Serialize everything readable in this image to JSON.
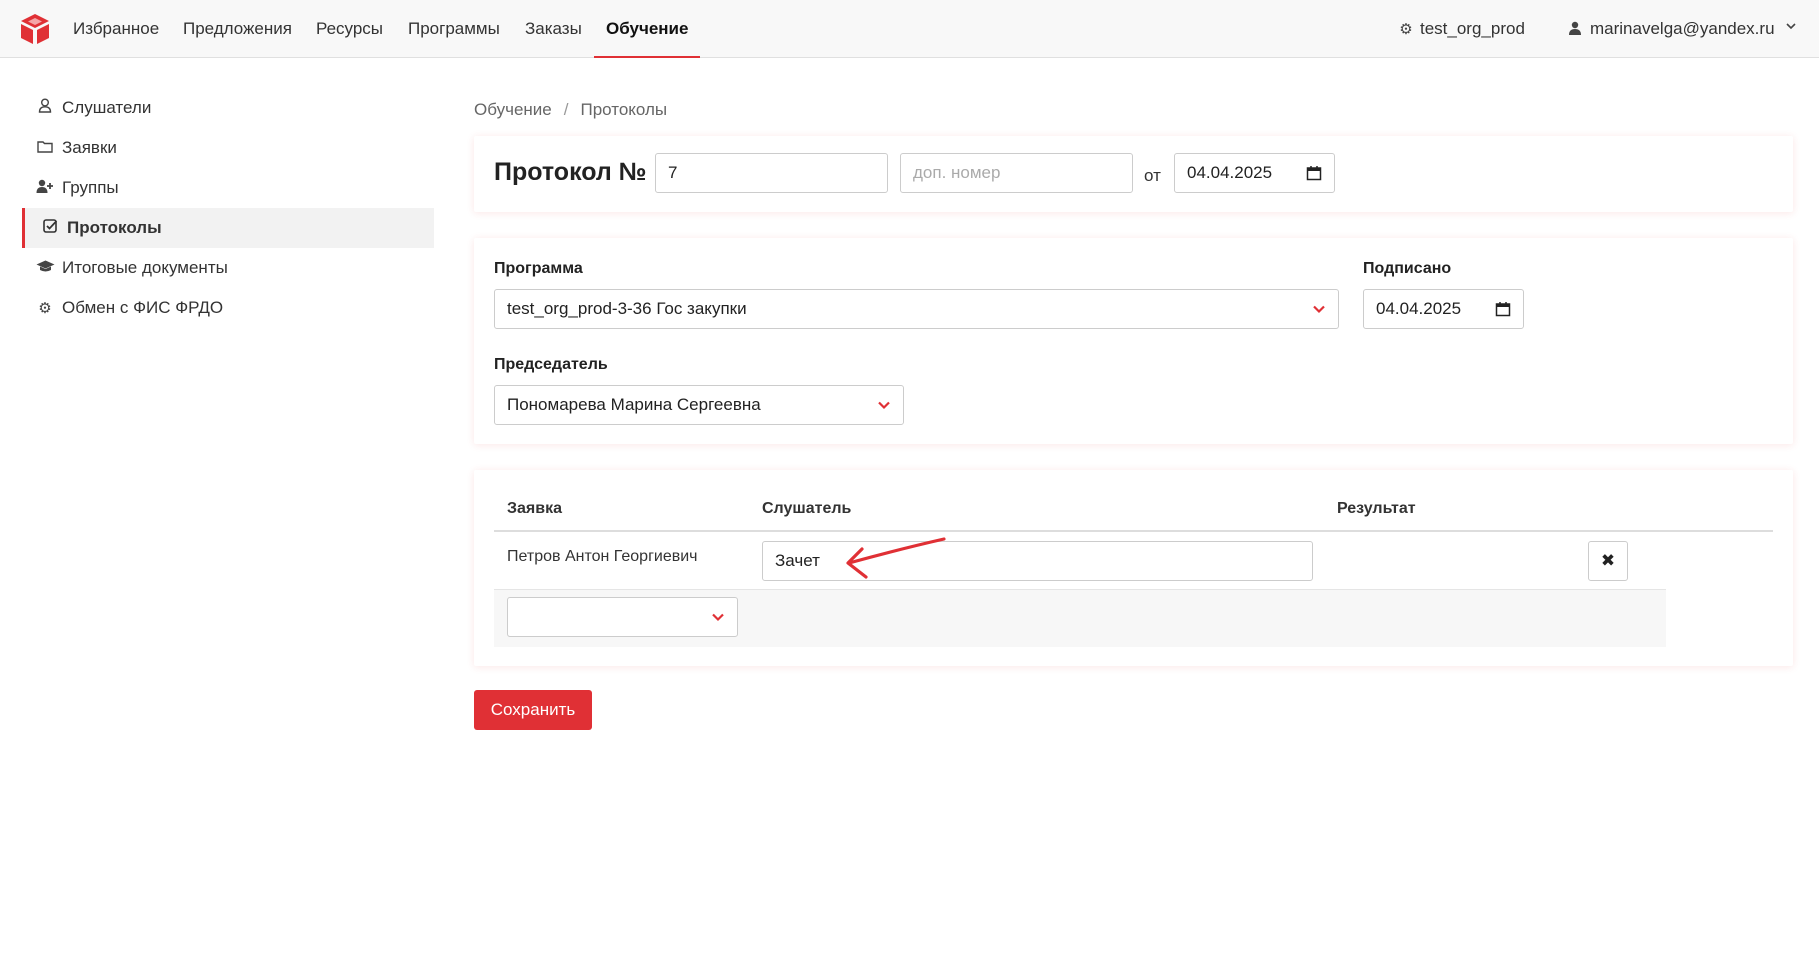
{
  "nav": {
    "items": [
      "Избранное",
      "Предложения",
      "Ресурсы",
      "Программы",
      "Заказы",
      "Обучение"
    ],
    "active": "Обучение",
    "org": "test_org_prod",
    "user": "marinavelga@yandex.ru"
  },
  "sidebar": {
    "items": [
      {
        "label": "Слушатели",
        "icon": "user-icon"
      },
      {
        "label": "Заявки",
        "icon": "folder-icon"
      },
      {
        "label": "Группы",
        "icon": "user-plus-icon"
      },
      {
        "label": "Протоколы",
        "icon": "check-square-icon"
      },
      {
        "label": "Итоговые документы",
        "icon": "graduation-cap-icon"
      },
      {
        "label": "Обмен с ФИС ФРДО",
        "icon": "gear-icon"
      }
    ],
    "active": "Протоколы"
  },
  "breadcrumb": [
    "Обучение",
    "Протоколы"
  ],
  "protocol": {
    "title": "Протокол №",
    "number": "7",
    "extra_number_placeholder": "доп. номер",
    "from_label": "от",
    "date": "04.04.2025"
  },
  "details": {
    "program_label": "Программа",
    "program_value": "test_org_prod-3-36 Гос закупки",
    "signed_label": "Подписано",
    "signed_date": "04.04.2025",
    "chairman_label": "Председатель",
    "chairman_value": "Пономарева Марина Сергеевна"
  },
  "table": {
    "headers": [
      "Заявка",
      "Слушатель",
      "Результат"
    ],
    "rows": [
      {
        "name": "Петров Антон Георгиевич",
        "result": "Зачет"
      }
    ]
  },
  "actions": {
    "save_label": "Сохранить"
  },
  "colors": {
    "accent": "#e03035"
  }
}
